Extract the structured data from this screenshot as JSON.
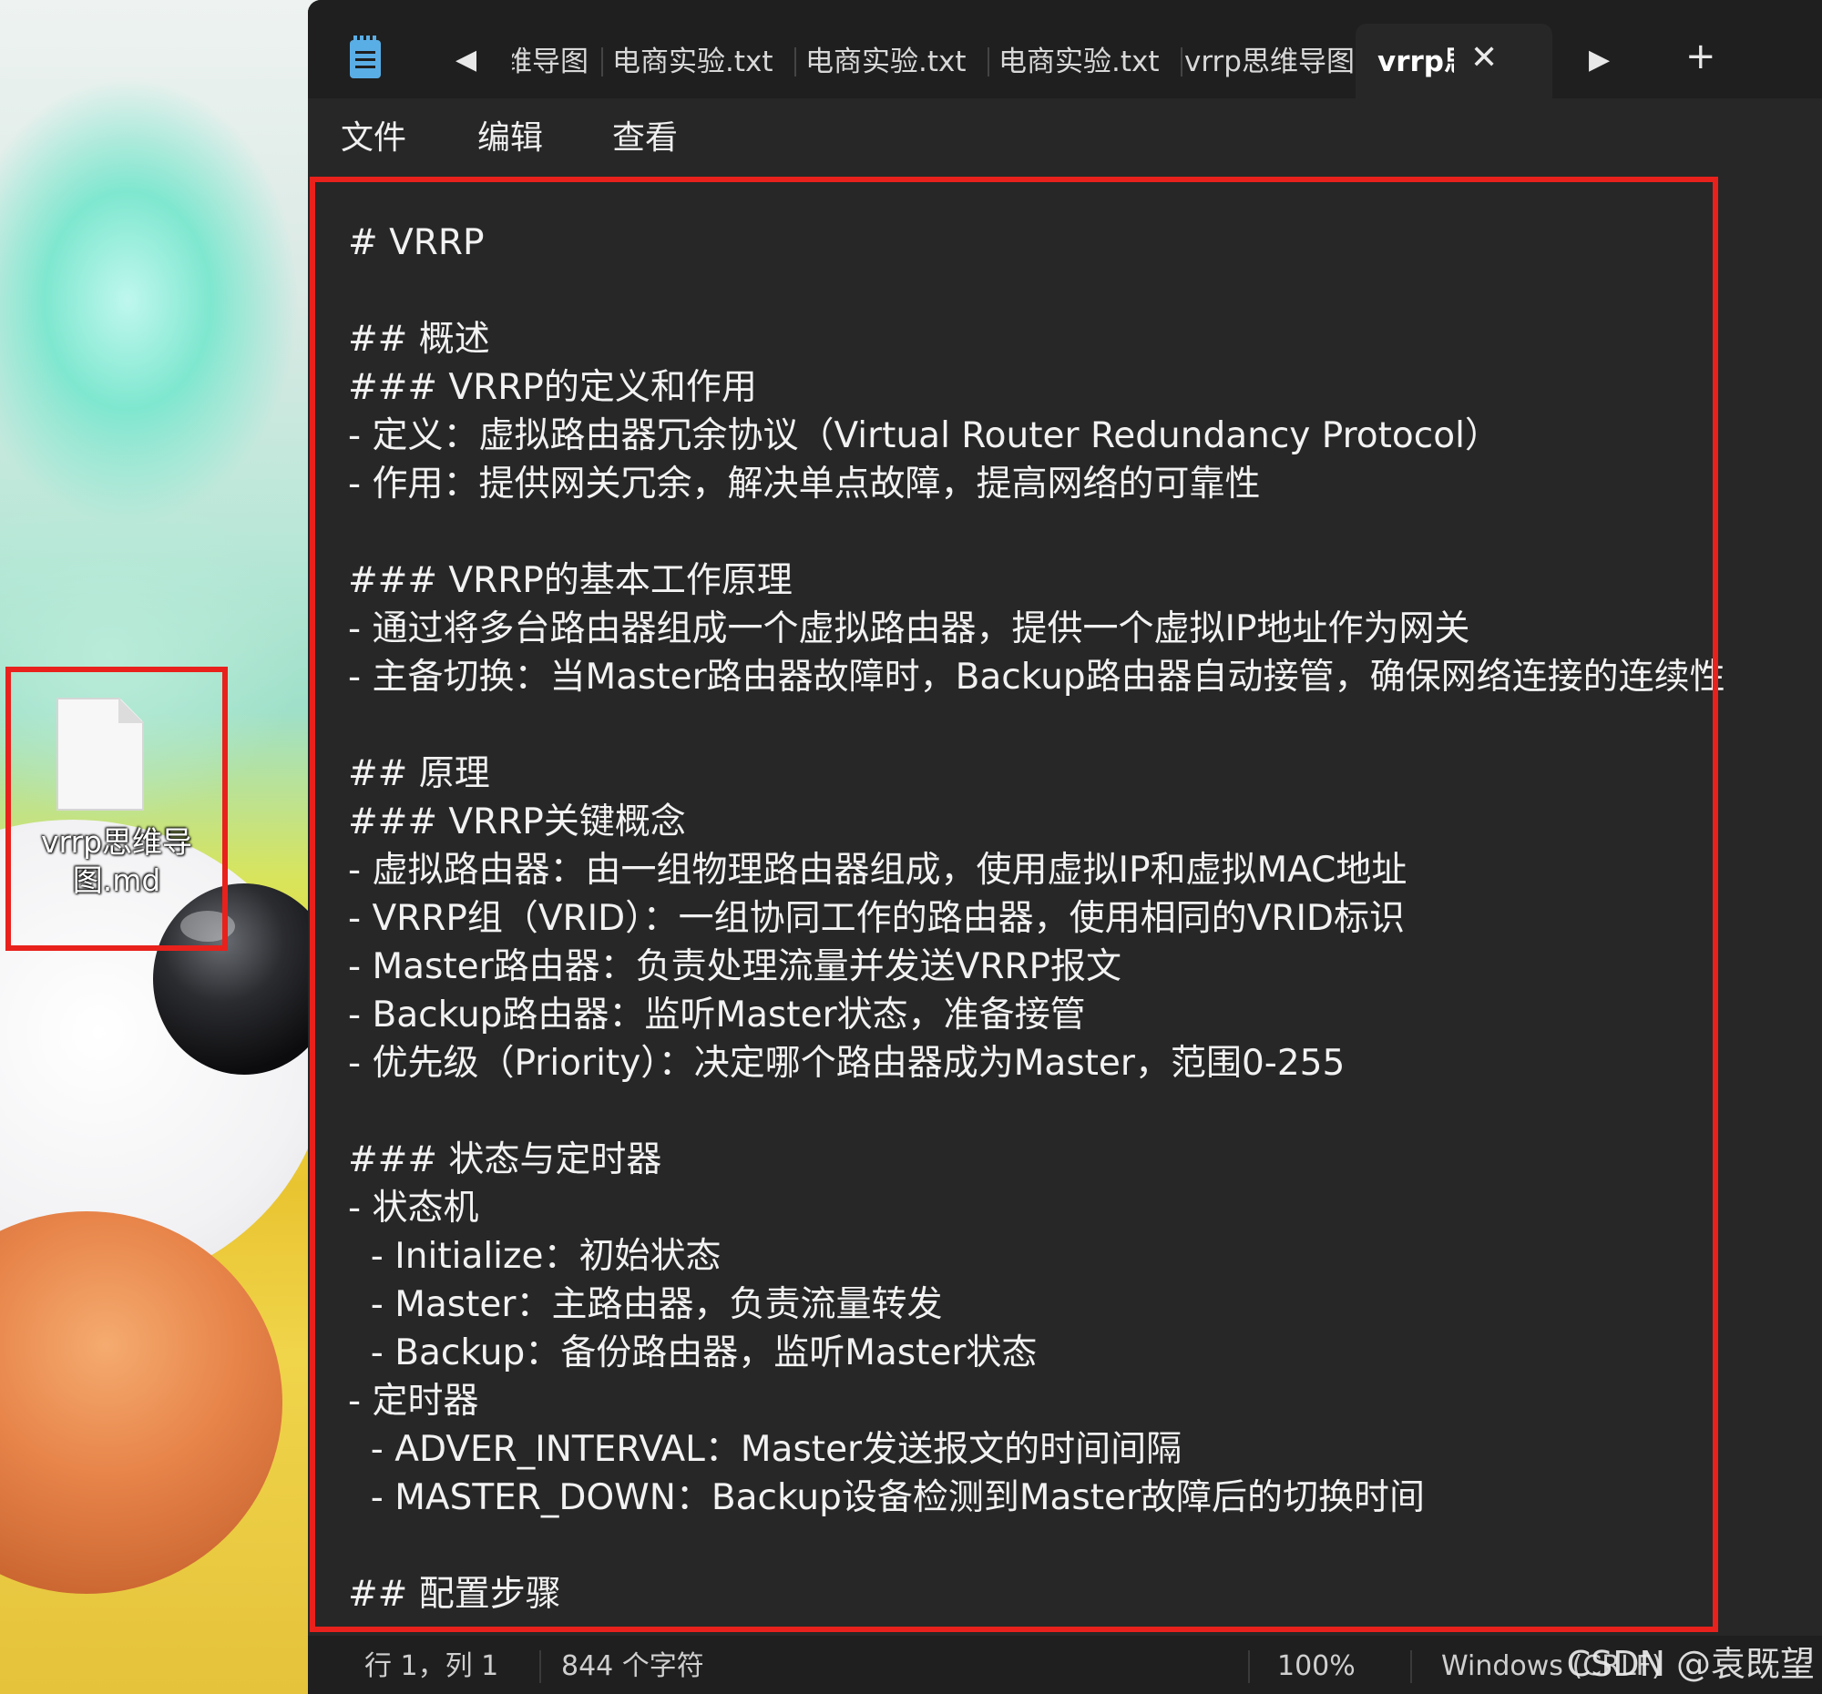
{
  "desktop": {
    "icon_label": "vrrp思维导\n图.md"
  },
  "window": {
    "tabs": [
      {
        "label": "vrrp思维导图"
      },
      {
        "label": "电商实验.txt"
      },
      {
        "label": "电商实验.txt"
      },
      {
        "label": "电商实验.txt"
      },
      {
        "label": "vrrp思维导图"
      }
    ],
    "active_tab": {
      "label": "vrrp思维导图.md"
    },
    "tab_prev_glyph": "◀",
    "tab_next_glyph": "▶",
    "new_tab_glyph": "+",
    "close_glyph": "✕",
    "menu": {
      "file": "文件",
      "edit": "编辑",
      "view": "查看"
    },
    "content_lines": [
      "# VRRP",
      "",
      "## 概述",
      "### VRRP的定义和作用",
      "- 定义：虚拟路由器冗余协议（Virtual Router Redundancy Protocol）",
      "- 作用：提供网关冗余，解决单点故障，提高网络的可靠性",
      "",
      "### VRRP的基本工作原理",
      "- 通过将多台路由器组成一个虚拟路由器，提供一个虚拟IP地址作为网关",
      "- 主备切换：当Master路由器故障时，Backup路由器自动接管，确保网络连接的连续性",
      "",
      "## 原理",
      "### VRRP关键概念",
      "- 虚拟路由器：由一组物理路由器组成，使用虚拟IP和虚拟MAC地址",
      "- VRRP组（VRID）：一组协同工作的路由器，使用相同的VRID标识",
      "- Master路由器：负责处理流量并发送VRRP报文",
      "- Backup路由器：监听Master状态，准备接管",
      "- 优先级（Priority）：决定哪个路由器成为Master，范围0-255",
      "",
      "### 状态与定时器",
      "- 状态机",
      "  - Initialize：初始状态",
      "  - Master：主路由器，负责流量转发",
      "  - Backup：备份路由器，监听Master状态",
      "- 定时器",
      "  - ADVER_INTERVAL：Master发送报文的时间间隔",
      "  - MASTER_DOWN：Backup设备检测到Master故障后的切换时间",
      "",
      "## 配置步骤"
    ],
    "status": {
      "position": "行 1，列 1",
      "char_count": "844 个字符",
      "zoom": "100%",
      "line_ending": "Windows (CRLF)"
    }
  },
  "watermark": "CSDN @袁既望",
  "colors": {
    "highlight_border": "#e8211c",
    "editor_bg": "#272727",
    "text": "#f2f2f2"
  }
}
